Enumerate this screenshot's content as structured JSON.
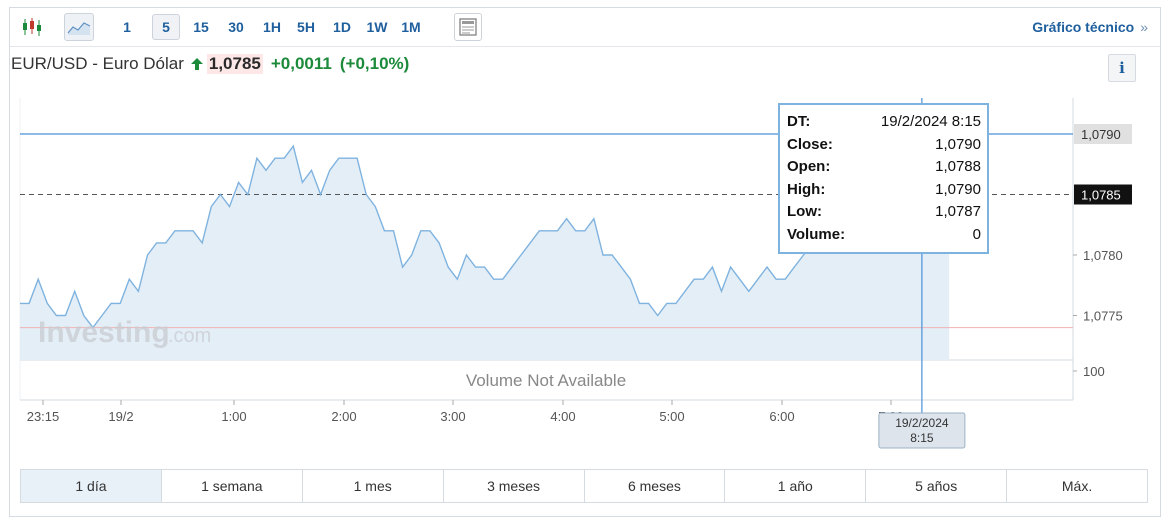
{
  "toolbar": {
    "icons": [
      "candlestick-icon",
      "area-chart-icon",
      "news-icon"
    ],
    "intervals": [
      "1",
      "5",
      "15",
      "30",
      "1H",
      "5H",
      "1D",
      "1W",
      "1M"
    ],
    "selected_interval": "5",
    "tech_chart_label": "Gráfico técnico",
    "tech_chart_chevron": "»"
  },
  "instrument": {
    "name": "EUR/USD - Euro Dólar",
    "price": "1,0785",
    "change": "+0,0011",
    "change_pct": "(+0,10%)",
    "up_color": "#1b8a3a",
    "info_label": "i"
  },
  "chart_data": {
    "type": "area",
    "x_ticks": [
      "23:15",
      "19/2",
      "1:00",
      "2:00",
      "3:00",
      "4:00",
      "5:00",
      "6:00",
      "7:00"
    ],
    "y_ticks": [
      "1,0790",
      "1,0785",
      "1,0780",
      "1,0775"
    ],
    "ylim": [
      1.07725,
      1.07925
    ],
    "values": [
      1.0776,
      1.0776,
      1.0778,
      1.0776,
      1.0775,
      1.0775,
      1.0777,
      1.0775,
      1.0774,
      1.0775,
      1.0776,
      1.0776,
      1.0778,
      1.0777,
      1.078,
      1.0781,
      1.0781,
      1.0782,
      1.0782,
      1.0782,
      1.0781,
      1.0784,
      1.0785,
      1.0784,
      1.0786,
      1.0785,
      1.0788,
      1.0787,
      1.0788,
      1.0788,
      1.0789,
      1.0786,
      1.0787,
      1.0785,
      1.0787,
      1.0788,
      1.0788,
      1.0788,
      1.0785,
      1.0784,
      1.0782,
      1.0782,
      1.0779,
      1.078,
      1.0782,
      1.0782,
      1.0781,
      1.0779,
      1.0778,
      1.078,
      1.0779,
      1.0779,
      1.0778,
      1.0778,
      1.0779,
      1.078,
      1.0781,
      1.0782,
      1.0782,
      1.0782,
      1.0783,
      1.0782,
      1.0782,
      1.0783,
      1.078,
      1.078,
      1.0779,
      1.0778,
      1.0776,
      1.0776,
      1.0775,
      1.0776,
      1.0776,
      1.0777,
      1.0778,
      1.0778,
      1.0779,
      1.0777,
      1.0779,
      1.0778,
      1.0777,
      1.0778,
      1.0779,
      1.0778,
      1.0778,
      1.0779,
      1.078,
      1.0781,
      1.0782,
      1.0783,
      1.0783,
      1.0782,
      1.0783,
      1.0784,
      1.0786,
      1.0787,
      1.0788,
      1.0788,
      1.0789,
      1.079,
      1.0788,
      1.0788,
      1.0785
    ],
    "last_price": 1.0785,
    "crosshair_value": 1.079,
    "crosshair_label": "1,0790",
    "last_label": "1,0785",
    "low_line": 1.0774,
    "volume_tick": "100",
    "volume_text": "Volume Not Available",
    "crosshair_date": "19/2/2024",
    "crosshair_time": "8:15",
    "watermark": "Investing",
    "watermark_suffix": ".com",
    "line_color": "#7fb3df",
    "fill_color": "#e4eef7",
    "crosshair_color": "#4a90d9",
    "low_line_color": "#f0b3b3"
  },
  "tooltip": [
    {
      "label": "DT:",
      "value": "19/2/2024 8:15"
    },
    {
      "label": "Close:",
      "value": "1,0790"
    },
    {
      "label": "Open:",
      "value": "1,0788"
    },
    {
      "label": "High:",
      "value": "1,0790"
    },
    {
      "label": "Low:",
      "value": "1,0787"
    },
    {
      "label": "Volume:",
      "value": "0"
    }
  ],
  "ranges": [
    "1 día",
    "1 semana",
    "1 mes",
    "3 meses",
    "6 meses",
    "1 año",
    "5 años",
    "Máx."
  ],
  "active_range": "1 día"
}
